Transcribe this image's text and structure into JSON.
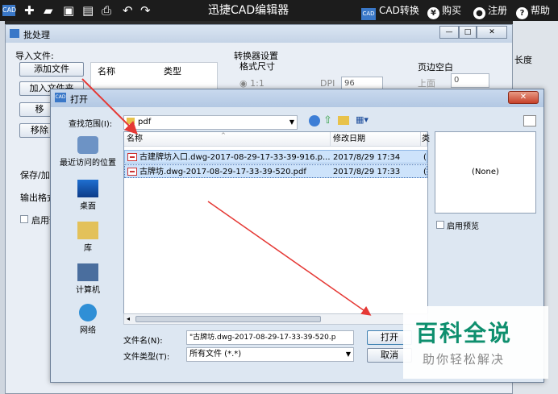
{
  "appbar": {
    "title": "迅捷CAD编辑器",
    "cad_convert": "CAD转换",
    "buy": "购买",
    "register": "注册",
    "help": "帮助",
    "logo_left": "CAD",
    "cad_logo": "CAD",
    "buy_icon": "¥"
  },
  "batch": {
    "title": "批处理",
    "import_label": "导入文件:",
    "add_file": "添加文件",
    "add_folder": "加入文件夹",
    "remove_partial": "移",
    "remove2_partial": "移除",
    "col_name": "名称",
    "col_type": "类型",
    "save_label": "保存/加载",
    "output_format_label": "输出格式",
    "enable_label": "启用预",
    "converter_settings": "转换器设置",
    "format_size": "格式尺寸",
    "scale_option": "1:1",
    "dpi_label": "DPI",
    "dpi_value": "96",
    "margin_title": "页边空白",
    "margin_top_label": "上面",
    "margin_top_value": "0",
    "length_label": "长度"
  },
  "open_dialog": {
    "title": "打开",
    "lookin_label": "查找范围(I):",
    "lookin_value": "pdf",
    "places": [
      "最近访问的位置",
      "桌面",
      "库",
      "计算机",
      "网络"
    ],
    "columns": {
      "name": "名称",
      "modified": "修改日期",
      "third": "类"
    },
    "files": [
      {
        "name": "古建牌坊入口.dwg-2017-08-29-17-33-39-916.p...",
        "modified": "2017/8/29 17:34",
        "third": "("
      },
      {
        "name": "古牌坊.dwg-2017-08-29-17-33-39-520.pdf",
        "modified": "2017/8/29 17:33",
        "third": "("
      }
    ],
    "preview_none": "(None)",
    "enable_preview": "启用预览",
    "filename_label": "文件名(N):",
    "filename_value": "\"古牌坊.dwg-2017-08-29-17-33-39-520.p",
    "filetype_label": "文件类型(T):",
    "filetype_value": "所有文件 (*.*)",
    "open_button": "打开",
    "cancel_button": "取消"
  },
  "watermark": {
    "main": "百科全说",
    "sub": "助你轻松解决"
  },
  "colors": {
    "arrow": "#e53935",
    "watermark_green": "#0e8f6e"
  }
}
